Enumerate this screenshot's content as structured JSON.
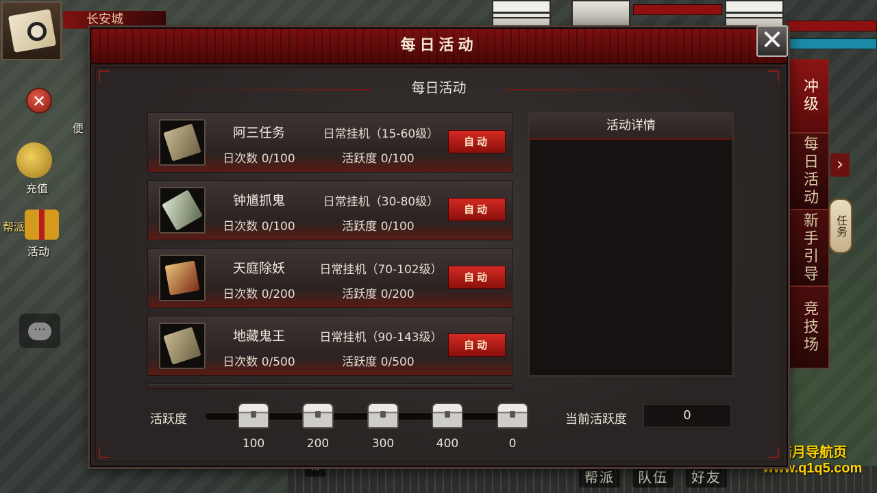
{
  "world": {
    "city_name": "长安城",
    "left_icons": [
      {
        "label": "便"
      },
      {
        "label": "充值"
      },
      {
        "label": "帮派"
      },
      {
        "label": "活动"
      }
    ],
    "bottom_menu": [
      "帮派",
      "队伍",
      "好友"
    ],
    "right_tabs": [
      "冲级",
      "每日活动",
      "新手引导",
      "竞技场"
    ],
    "task_lantern": "任务",
    "watermark": {
      "line1": "踏月导航页",
      "line2": "www.q1q5.com"
    }
  },
  "dialog": {
    "title": "每日活动",
    "subtitle": "每日活动",
    "detail_title": "活动详情",
    "activities": [
      {
        "name": "阿三任务",
        "type": "日常挂机（15-60级）",
        "count": "日次数 0/100",
        "activeness": "活跃度 0/100",
        "button": "自动"
      },
      {
        "name": "钟馗抓鬼",
        "type": "日常挂机（30-80级）",
        "count": "日次数 0/100",
        "activeness": "活跃度 0/100",
        "button": "自动"
      },
      {
        "name": "天庭除妖",
        "type": "日常挂机（70-102级）",
        "count": "日次数 0/200",
        "activeness": "活跃度 0/200",
        "button": "自动"
      },
      {
        "name": "地藏鬼王",
        "type": "日常挂机（90-143级）",
        "count": "日次数 0/500",
        "activeness": "活跃度 0/500",
        "button": "自动"
      }
    ],
    "activeness": {
      "label": "活跃度",
      "progress": 0,
      "rewards": [
        "100",
        "200",
        "300",
        "400",
        "0"
      ],
      "current_label": "当前活跃度",
      "current_value": "0"
    }
  }
}
